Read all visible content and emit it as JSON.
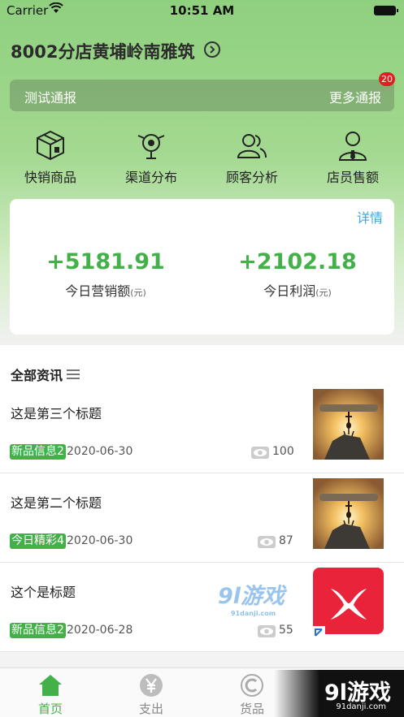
{
  "status_bar": {
    "carrier": "Carrier",
    "time": "10:51 AM"
  },
  "header": {
    "store_name": "8002分店黄埔岭南雅筑"
  },
  "notice": {
    "text": "测试通报",
    "more": "更多通报",
    "badge": "20"
  },
  "quick_actions": [
    {
      "label": "快销商品",
      "icon": "package-icon"
    },
    {
      "label": "渠道分布",
      "icon": "channel-icon"
    },
    {
      "label": "顾客分析",
      "icon": "customers-icon"
    },
    {
      "label": "店员售额",
      "icon": "staff-icon"
    }
  ],
  "summary_card": {
    "detail": "详情",
    "sales_value": "+5181.91",
    "sales_label": "今日营销额",
    "sales_unit": "(元)",
    "profit_value": "+2102.18",
    "profit_label": "今日利润",
    "profit_unit": "(元)"
  },
  "news": {
    "heading": "全部资讯",
    "items": [
      {
        "title": "这是第三个标题",
        "tag": "新品信息2",
        "date": "2020-06-30",
        "views": "100"
      },
      {
        "title": "这是第二个标题",
        "tag": "今日精彩4",
        "date": "2020-06-30",
        "views": "87"
      },
      {
        "title": "这个是标题",
        "tag": "新品信息2",
        "date": "2020-06-28",
        "views": "55"
      }
    ]
  },
  "watermark": {
    "text": "9l游戏",
    "sub": "91danji.com"
  },
  "tabs": [
    {
      "label": "首页",
      "active": true
    },
    {
      "label": "支出",
      "active": false
    },
    {
      "label": "货品",
      "active": false
    }
  ],
  "corner_logo": {
    "text": "9l游戏",
    "sub": "91danji.com"
  },
  "colors": {
    "accent": "#43b049",
    "link": "#3aa8e0",
    "badge": "#e02020"
  }
}
